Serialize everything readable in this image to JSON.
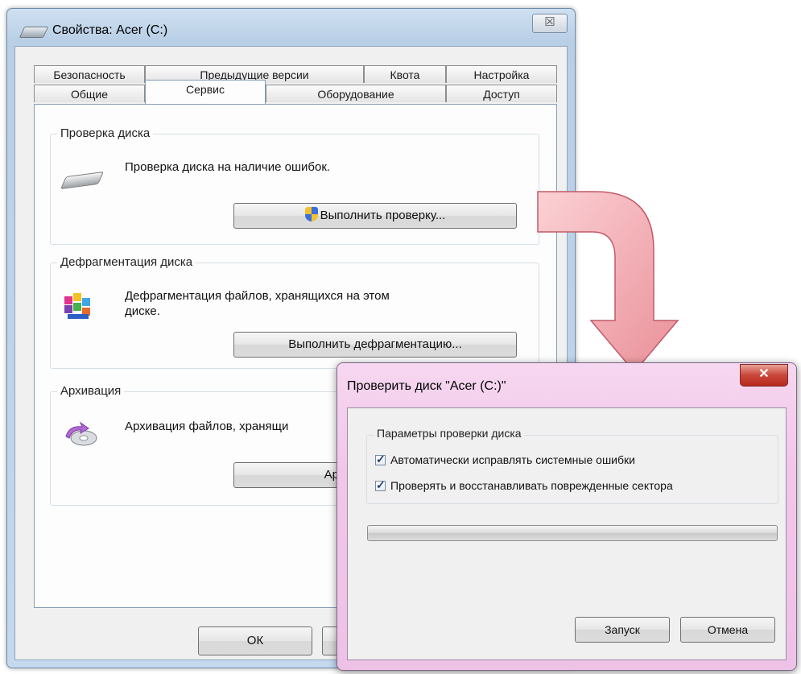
{
  "properties_window": {
    "title": "Свойства: Acer (C:)",
    "close_glyph": "☒",
    "tabs_row1": [
      "Безопасность",
      "Предыдущие версии",
      "Квота",
      "Настройка"
    ],
    "tabs_row2": [
      "Общие",
      "Сервис",
      "Оборудование",
      "Доступ"
    ],
    "active_tab": "Сервис",
    "check_group": {
      "title": "Проверка диска",
      "description": "Проверка диска на наличие ошибок.",
      "button": "Выполнить проверку..."
    },
    "defrag_group": {
      "title": "Дефрагментация диска",
      "description_line1": "Дефрагментация файлов, хранящихся на этом",
      "description_line2": "диске.",
      "button": "Выполнить дефрагментацию..."
    },
    "backup_group": {
      "title": "Архивация",
      "description": "Архивация файлов, хранящи",
      "button_partial": "Ар"
    },
    "ok_button": "ОК"
  },
  "check_dialog": {
    "title": "Проверить диск \"Acer (C:)\"",
    "close_glyph": "✕",
    "options_group_title": "Параметры проверки диска",
    "options": [
      {
        "label": "Автоматически исправлять системные ошибки",
        "checked": true
      },
      {
        "label": "Проверять и восстанавливать поврежденные сектора",
        "checked": true
      }
    ],
    "progress": 0,
    "start_button": "Запуск",
    "cancel_button": "Отмена"
  },
  "colors": {
    "arrow_fill": "#f2a9ae",
    "dialog_frame": "#f2c6e9",
    "close_red": "#c9473a"
  }
}
